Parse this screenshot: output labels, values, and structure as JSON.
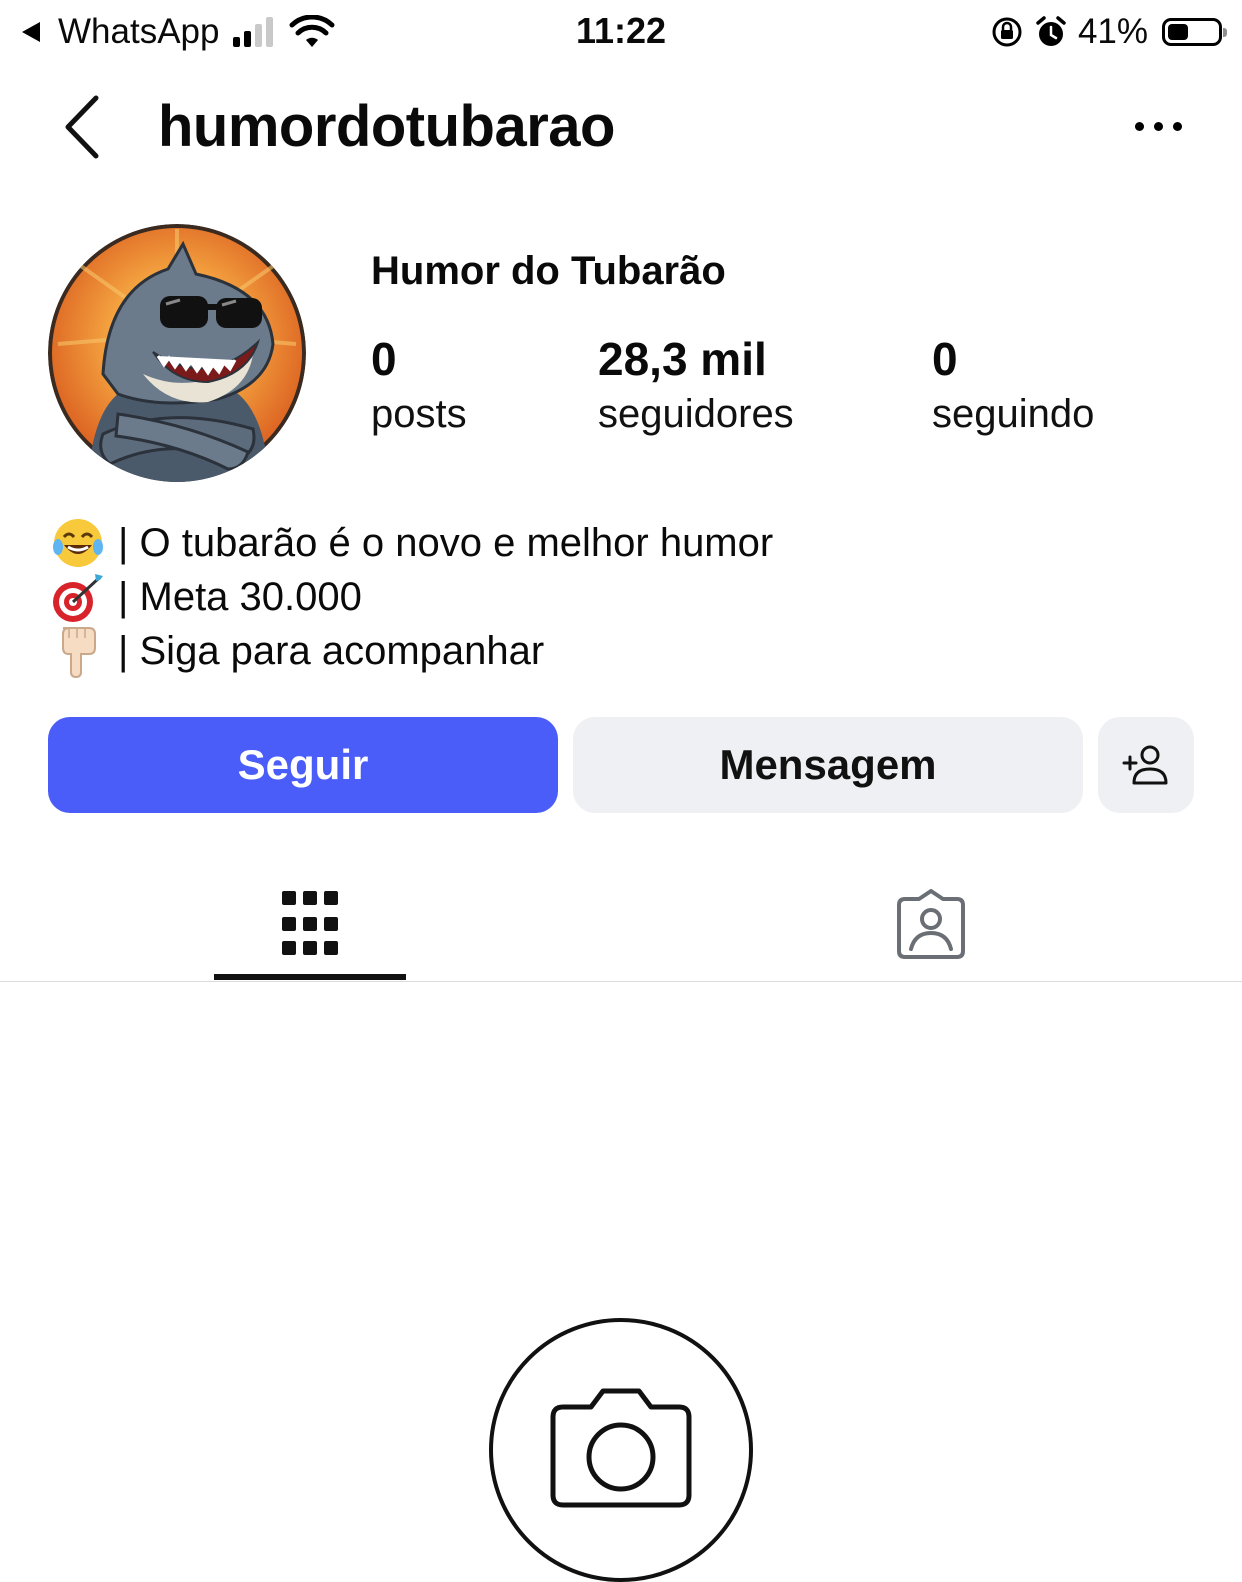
{
  "status_bar": {
    "back_app": "WhatsApp",
    "time": "11:22",
    "battery_percent": "41%",
    "battery_level": 0.41,
    "signal_bars": 2
  },
  "header": {
    "username": "humordotubarao"
  },
  "profile": {
    "display_name": "Humor do Tubarão",
    "stats": [
      {
        "value": "0",
        "label": "posts"
      },
      {
        "value": "28,3 mil",
        "label": "seguidores"
      },
      {
        "value": "0",
        "label": "seguindo"
      }
    ],
    "bio": [
      {
        "icon": "laughing-tears-emoji",
        "text": "| O tubarão é o novo e melhor humor"
      },
      {
        "icon": "target-dart-emoji",
        "text": "| Meta 30.000"
      },
      {
        "icon": "pointing-down-hand-emoji",
        "text": "| Siga para acompanhar"
      }
    ]
  },
  "actions": {
    "follow_label": "Seguir",
    "message_label": "Mensagem"
  },
  "tabs": [
    {
      "icon": "grid-icon",
      "active": true
    },
    {
      "icon": "tagged-person-icon",
      "active": false
    }
  ],
  "colors": {
    "follow_button": "#4a5df9",
    "secondary_button": "#eff0f4",
    "avatar_background": "#e8772a"
  }
}
